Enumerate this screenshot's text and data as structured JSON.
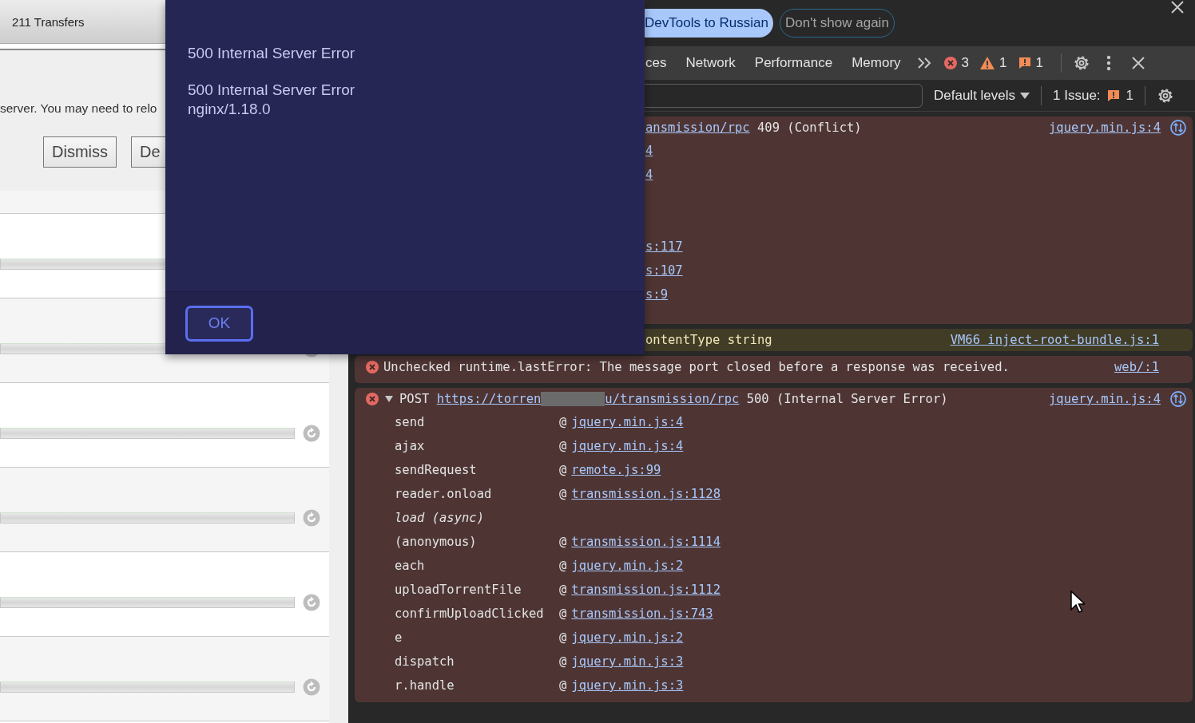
{
  "app": {
    "header": {
      "title": "211 Transfers"
    },
    "dialog": {
      "message": "server. You may need to relo",
      "buttons": [
        "Dismiss",
        "De"
      ]
    },
    "transfers": [
      {
        "level": 0
      },
      {
        "level": 0,
        "retry": true
      },
      {
        "level": 0,
        "retry": true
      },
      {
        "level": 0,
        "retry": true
      },
      {
        "level": 0,
        "retry": true
      },
      {
        "level": 0,
        "retry": true
      }
    ]
  },
  "alert": {
    "paragraphs": [
      [
        "500 Internal Server Error"
      ],
      [
        "500 Internal Server Error",
        "nginx/1.18.0"
      ]
    ],
    "button": "OK"
  },
  "devtools": {
    "infobar": {
      "action": "DevTools to Russian",
      "dismiss": "Don't show again"
    },
    "tabs": [
      {
        "label": "ces",
        "selected": false
      },
      {
        "label": "Network",
        "selected": false
      },
      {
        "label": "Performance",
        "selected": false
      },
      {
        "label": "Memory",
        "selected": false
      }
    ],
    "counts": {
      "errors": "3",
      "warnings": "1",
      "issues": "1"
    },
    "filter": {
      "levels": "Default levels",
      "issues_label": "1 Issue:",
      "issues_count": "1"
    },
    "messages": [
      {
        "kind": "error",
        "url": [
          "ansmission/rpc"
        ],
        "text": " 409 (Conflict)",
        "source": "jquery.min.js:4",
        "network": true,
        "stack": [
          {
            "link": "4"
          },
          {
            "link": "4"
          },
          {
            "link": "s:117"
          },
          {
            "link": "s:107"
          },
          {
            "link": "s:9"
          }
        ]
      },
      {
        "kind": "warning",
        "text": "ontentType string",
        "source": "VM66 inject-root-bundle.js:1"
      },
      {
        "kind": "error",
        "icon": true,
        "text": "Unchecked runtime.lastError: The message port closed before a response was received.",
        "source": "web/:1"
      },
      {
        "kind": "error",
        "icon": true,
        "expanded": true,
        "method": "POST ",
        "url": [
          "https://torren",
          "u/transmission/rpc"
        ],
        "text": " 500 (Internal Server Error)",
        "source": "jquery.min.js:4",
        "network": true,
        "stack": [
          {
            "function": "send",
            "at": "@",
            "link": "jquery.min.js:4"
          },
          {
            "function": "ajax",
            "at": "@",
            "link": "jquery.min.js:4"
          },
          {
            "function": "sendRequest",
            "at": "@",
            "link": "remote.js:99"
          },
          {
            "function": "reader.onload",
            "at": "@",
            "link": "transmission.js:1128"
          },
          {
            "function": "load (async)",
            "kind": "async"
          },
          {
            "function": "(anonymous)",
            "at": "@",
            "link": "transmission.js:1114"
          },
          {
            "function": "each",
            "at": "@",
            "link": "jquery.min.js:2"
          },
          {
            "function": "uploadTorrentFile",
            "at": "@",
            "link": "transmission.js:1112"
          },
          {
            "function": "confirmUploadClicked",
            "at": "@",
            "link": "transmission.js:743"
          },
          {
            "function": "e",
            "at": "@",
            "link": "jquery.min.js:2"
          },
          {
            "function": "dispatch",
            "at": "@",
            "link": "jquery.min.js:3"
          },
          {
            "function": "r.handle",
            "at": "@",
            "link": "jquery.min.js:3"
          }
        ]
      }
    ]
  }
}
